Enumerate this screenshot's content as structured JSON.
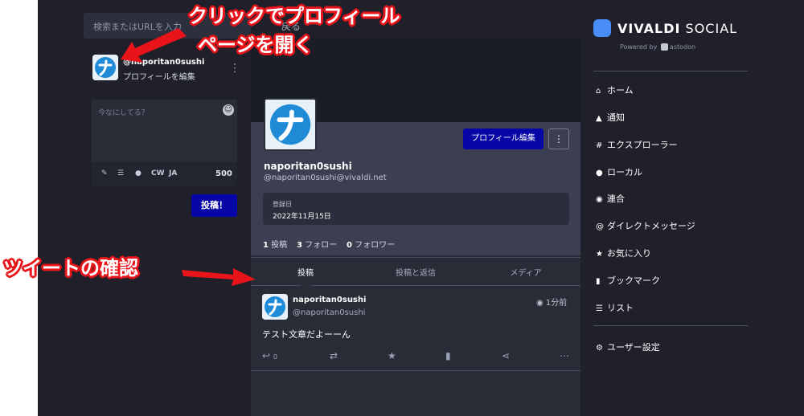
{
  "search": {
    "placeholder": "検索またはURLを入力",
    "back": "戻る"
  },
  "account": {
    "handle": "@naporitan0sushi",
    "edit_profile": "プロフィールを編集",
    "menu": "⋮"
  },
  "compose": {
    "placeholder": "今なにしてる？",
    "cw": "CW",
    "lang": "JA",
    "char_count": "500",
    "submit": "投稿！"
  },
  "profile": {
    "edit_button": "プロフィール編集",
    "more": "⋮",
    "display_name": "naporitan0sushi",
    "handle": "@naporitan0sushi@vivaldi.net",
    "joined_label": "登録日",
    "joined_date": "2022年11月15日",
    "posts_count": "1",
    "posts_label": "投稿",
    "following_count": "3",
    "following_label": "フォロー",
    "followers_count": "0",
    "followers_label": "フォロワー"
  },
  "tabs": [
    {
      "label": "投稿"
    },
    {
      "label": "投稿と返信"
    },
    {
      "label": "メディア"
    }
  ],
  "status": {
    "name": "naporitan0sushi",
    "handle": "@naporitan0sushi",
    "time": "1分前",
    "text": "テスト文章だよーーん",
    "reply_count": "0"
  },
  "brand": {
    "name_bold": "VIVALDI",
    "name_light": "SOCIAL",
    "powered_prefix": "Powered by",
    "powered_suffix": "astodon"
  },
  "nav": {
    "items": [
      {
        "icon": "home-icon",
        "glyph": "⌂",
        "label": "ホーム"
      },
      {
        "icon": "bell-icon",
        "glyph": "▲",
        "label": "通知"
      },
      {
        "icon": "hashtag-icon",
        "glyph": "#",
        "label": "エクスプローラー"
      },
      {
        "icon": "users-icon",
        "glyph": "●",
        "label": "ローカル"
      },
      {
        "icon": "globe-icon",
        "glyph": "◉",
        "label": "連合"
      },
      {
        "icon": "at-icon",
        "glyph": "@",
        "label": "ダイレクトメッセージ"
      },
      {
        "icon": "star-icon",
        "glyph": "★",
        "label": "お気に入り"
      },
      {
        "icon": "bookmark-icon",
        "glyph": "▮",
        "label": "ブックマーク"
      },
      {
        "icon": "list-icon",
        "glyph": "☰",
        "label": "リスト"
      }
    ],
    "settings": {
      "icon": "gear-icon",
      "glyph": "⚙",
      "label": "ユーザー設定"
    }
  },
  "annotations": {
    "profile_line1": "クリックでプロフィール",
    "profile_line2": "ページを開く",
    "tweet_check": "ツイートの確認"
  },
  "colors": {
    "accent": "#0605a6",
    "annotation": "#e8141a",
    "background": "#1f2029",
    "vivaldi": "#4a8df8"
  }
}
